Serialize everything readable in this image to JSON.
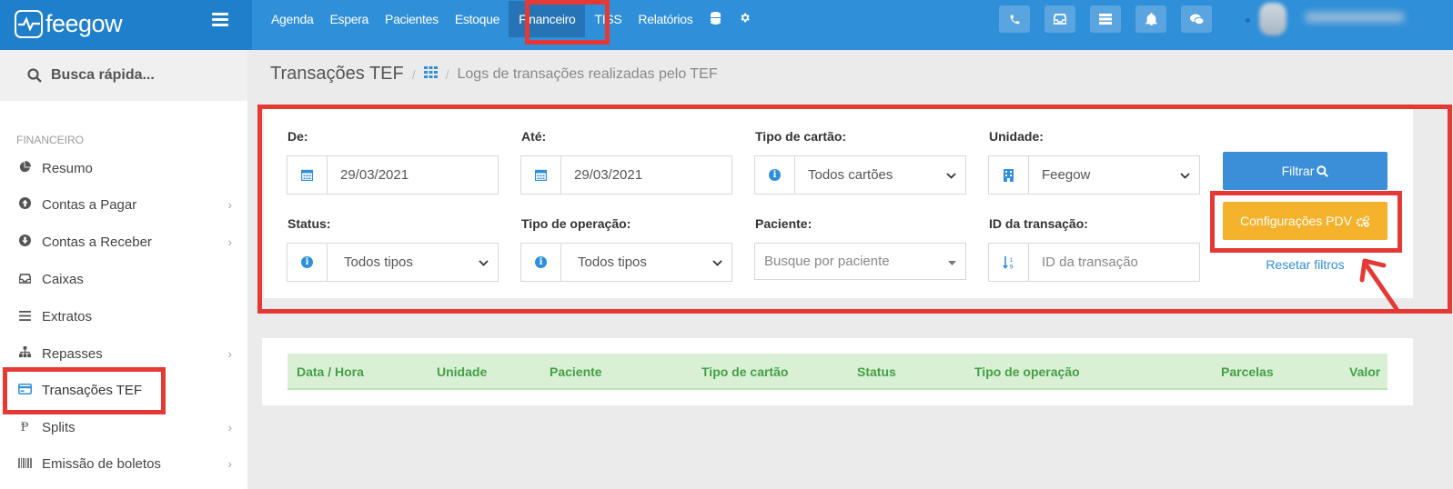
{
  "app": {
    "logo_text": "feegow"
  },
  "topnav": {
    "items": [
      "Agenda",
      "Espera",
      "Pacientes",
      "Estoque",
      "Financeiro",
      "TISS",
      "Relatórios"
    ],
    "active": "Financeiro",
    "icons": [
      "database-icon",
      "gear-icon"
    ],
    "right_icons": [
      "phone-icon",
      "inbox-icon",
      "list-icon",
      "bell-icon",
      "chat-icon"
    ]
  },
  "sidebar": {
    "search_label": "Busca rápida...",
    "section": "FINANCEIRO",
    "items": [
      {
        "label": "Resumo",
        "icon": "pie-chart-icon",
        "chevron": false
      },
      {
        "label": "Contas a Pagar",
        "icon": "arrow-up-circle-icon",
        "chevron": true
      },
      {
        "label": "Contas a Receber",
        "icon": "arrow-down-circle-icon",
        "chevron": true
      },
      {
        "label": "Caixas",
        "icon": "inbox-icon",
        "chevron": false
      },
      {
        "label": "Extratos",
        "icon": "list-icon",
        "chevron": false
      },
      {
        "label": "Repasses",
        "icon": "sitemap-icon",
        "chevron": true
      },
      {
        "label": "Transações TEF",
        "icon": "credit-card-icon",
        "chevron": false,
        "active": true
      },
      {
        "label": "Splits",
        "icon": "split-icon",
        "chevron": true
      },
      {
        "label": "Emissão de boletos",
        "icon": "barcode-icon",
        "chevron": true
      }
    ]
  },
  "breadcrumb": {
    "title": "Transações TEF",
    "description": "Logs de transações realizadas pelo TEF"
  },
  "filters": {
    "de_label": "De:",
    "de_value": "29/03/2021",
    "ate_label": "Até:",
    "ate_value": "29/03/2021",
    "tipo_cartao_label": "Tipo de cartão:",
    "tipo_cartao_value": "Todos cartões",
    "unidade_label": "Unidade:",
    "unidade_value": "Feegow",
    "status_label": "Status:",
    "status_value": "Todos tipos",
    "tipo_operacao_label": "Tipo de operação:",
    "tipo_operacao_value": "Todos tipos",
    "paciente_label": "Paciente:",
    "paciente_placeholder": "Busque por paciente",
    "id_label": "ID da transação:",
    "id_placeholder": "ID da transação",
    "filtrar_label": "Filtrar",
    "config_label": "Configurações PDV",
    "reset_label": "Resetar filtros"
  },
  "table": {
    "columns": [
      "Data / Hora",
      "Unidade",
      "Paciente",
      "Tipo de cartão",
      "Status",
      "Tipo de operação",
      "Parcelas",
      "Valor"
    ],
    "rows": []
  },
  "colors": {
    "topbar": "#2f8fd8",
    "primary_button": "#3a8fd8",
    "warning_button": "#f5b22c",
    "table_header_bg": "#d9f0d4",
    "table_header_text": "#43a047",
    "annotation": "#e53935"
  }
}
